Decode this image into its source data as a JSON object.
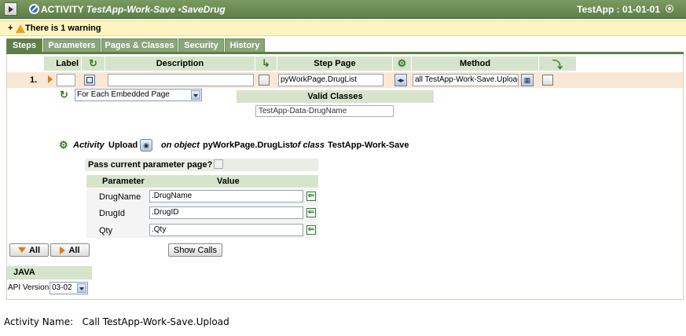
{
  "header": {
    "prefix": "ACTIVITY",
    "class_name": "TestApp-Work-Save",
    "separator": "•",
    "activity_name": "SaveDrug",
    "ruleset_version": "TestApp : 01-01-01"
  },
  "warning": {
    "toggle": "+",
    "text": "There is 1 warning"
  },
  "tabs": [
    {
      "label": "Steps",
      "active": true
    },
    {
      "label": "Parameters",
      "active": false
    },
    {
      "label": "Pages & Classes",
      "active": false
    },
    {
      "label": "Security",
      "active": false
    },
    {
      "label": "History",
      "active": false
    }
  ],
  "columns": {
    "label": "Label",
    "description": "Description",
    "step_page": "Step Page",
    "method": "Method"
  },
  "step": {
    "number": "1.",
    "label_value": "",
    "description_value": "",
    "step_page_value": "pyWorkPage.DrugList",
    "method_value": "all TestApp-Work-Save.Upload"
  },
  "loop": {
    "selected": "For Each Embedded Page"
  },
  "valid_classes": {
    "header": "Valid Classes",
    "value": "TestApp-Data-DrugName"
  },
  "call": {
    "activity_label": "Activity",
    "activity_value": "Upload",
    "on_object_label": "on object",
    "object_value": "pyWorkPage.DrugList",
    "of_class_label": "of class",
    "class_value": "TestApp-Work-Save"
  },
  "pass_param": {
    "label": "Pass current parameter page?"
  },
  "params": {
    "header_param": "Parameter",
    "header_value": "Value",
    "rows": [
      {
        "name": "DrugName",
        "value": ".DrugName"
      },
      {
        "name": "DrugId",
        "value": ".DrugID"
      },
      {
        "name": "Qty",
        "value": ".Qty"
      }
    ]
  },
  "buttons": {
    "expand_all": "All",
    "collapse_all": "All",
    "show_calls": "Show Calls"
  },
  "java": {
    "header": "JAVA",
    "api_label": "API Version",
    "api_value": "03-02"
  },
  "footer": {
    "caption": "Activity Name:   Call TestApp-Work-Save.Upload"
  },
  "colors": {
    "header_green": "#5d7f47",
    "column_header": "#d6e4cc",
    "warning_bg": "#fdf5c0",
    "step_row": "#fbe7d6",
    "arrow_orange": "#e07a10"
  }
}
